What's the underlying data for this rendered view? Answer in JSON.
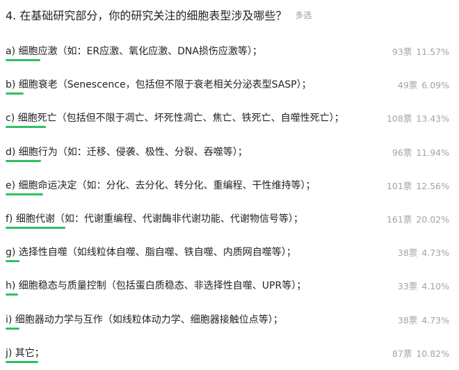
{
  "question": {
    "title": "4. 在基础研究部分，你的研究关注的细胞表型涉及哪些？",
    "tag": "多选"
  },
  "bar_color": "#2fbf64",
  "options": [
    {
      "label": "a) 细胞应激（如：ER应激、氧化应激、DNA损伤应激等）；",
      "count": "93票",
      "percent": "11.57%",
      "share": 0.1157
    },
    {
      "label": "b) 细胞衰老（Senescence，包括但不限于衰老相关分泌表型SASP）；",
      "count": "49票",
      "percent": "6.09%",
      "share": 0.0609
    },
    {
      "label": "c) 细胞死亡（包括但不限于凋亡、坏死性凋亡、焦亡、铁死亡、自噬性死亡）；",
      "count": "108票",
      "percent": "13.43%",
      "share": 0.1343
    },
    {
      "label": "d) 细胞行为（如：迁移、侵袭、极性、分裂、吞噬等）；",
      "count": "96票",
      "percent": "11.94%",
      "share": 0.1194
    },
    {
      "label": "e) 细胞命运决定（如：分化、去分化、转分化、重编程、干性维持等）；",
      "count": "101票",
      "percent": "12.56%",
      "share": 0.1256
    },
    {
      "label": "f) 细胞代谢（如：代谢重编程、代谢酶非代谢功能、代谢物信号等）；",
      "count": "161票",
      "percent": "20.02%",
      "share": 0.2002
    },
    {
      "label": "g) 选择性自噬（如线粒体自噬、脂自噬、铁自噬、内质网自噬等）；",
      "count": "38票",
      "percent": "4.73%",
      "share": 0.0473
    },
    {
      "label": "h) 细胞稳态与质量控制（包括蛋白质稳态、非选择性自噬、UPR等）；",
      "count": "33票",
      "percent": "4.10%",
      "share": 0.041
    },
    {
      "label": "i) 细胞器动力学与互作（如线粒体动力学、细胞器接触位点等）；",
      "count": "38票",
      "percent": "4.73%",
      "share": 0.0473
    },
    {
      "label": "j) 其它；",
      "count": "87票",
      "percent": "10.82%",
      "share": 0.1082
    }
  ]
}
